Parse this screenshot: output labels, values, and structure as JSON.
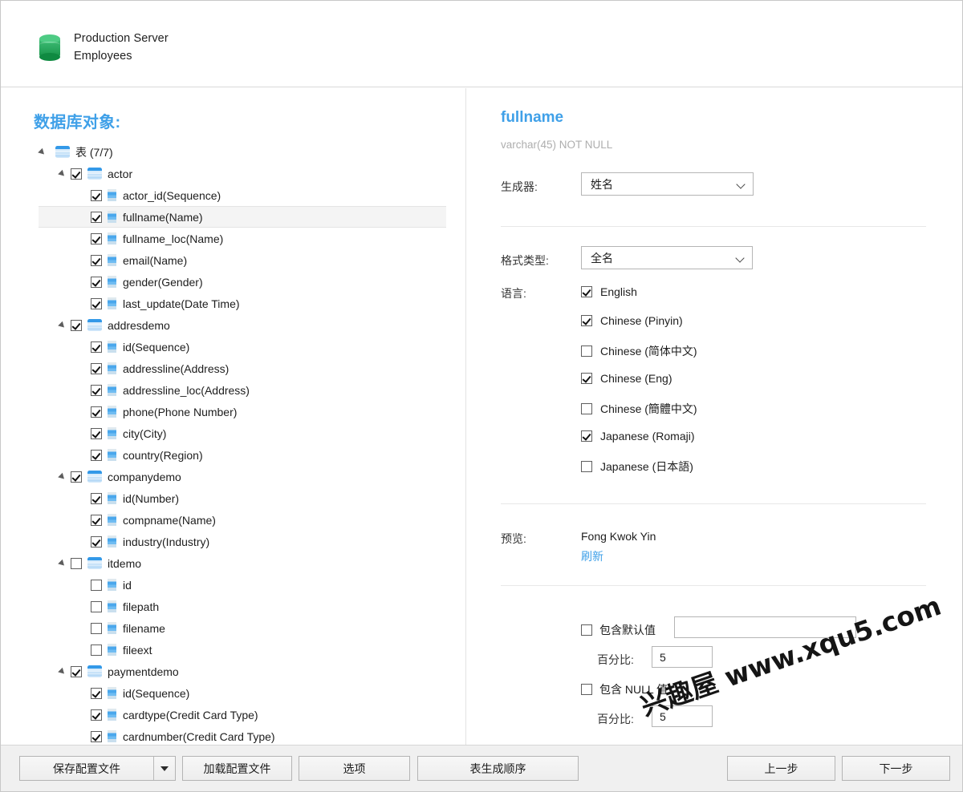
{
  "header": {
    "icon": "database-icon",
    "server": "Production Server",
    "database": "Employees"
  },
  "left_panel": {
    "title": "数据库对象:",
    "tree": [
      {
        "level": 0,
        "twisty": true,
        "checkbox": "none",
        "icon": "table-group-icon",
        "label": "表 (7/7)",
        "selected": false
      },
      {
        "level": 1,
        "twisty": true,
        "checkbox": "checked",
        "icon": "table-icon",
        "label": "actor",
        "selected": false
      },
      {
        "level": 2,
        "twisty": false,
        "checkbox": "checked",
        "icon": "column-icon",
        "label": "actor_id(Sequence)",
        "selected": false
      },
      {
        "level": 2,
        "twisty": false,
        "checkbox": "checked",
        "icon": "column-icon",
        "label": "fullname(Name)",
        "selected": true
      },
      {
        "level": 2,
        "twisty": false,
        "checkbox": "checked",
        "icon": "column-icon",
        "label": "fullname_loc(Name)",
        "selected": false
      },
      {
        "level": 2,
        "twisty": false,
        "checkbox": "checked",
        "icon": "column-icon",
        "label": "email(Name)",
        "selected": false
      },
      {
        "level": 2,
        "twisty": false,
        "checkbox": "checked",
        "icon": "column-icon",
        "label": "gender(Gender)",
        "selected": false
      },
      {
        "level": 2,
        "twisty": false,
        "checkbox": "checked",
        "icon": "column-icon",
        "label": "last_update(Date Time)",
        "selected": false
      },
      {
        "level": 1,
        "twisty": true,
        "checkbox": "checked",
        "icon": "table-icon",
        "label": "addresdemo",
        "selected": false
      },
      {
        "level": 2,
        "twisty": false,
        "checkbox": "checked",
        "icon": "column-icon",
        "label": "id(Sequence)",
        "selected": false
      },
      {
        "level": 2,
        "twisty": false,
        "checkbox": "checked",
        "icon": "column-icon",
        "label": "addressline(Address)",
        "selected": false
      },
      {
        "level": 2,
        "twisty": false,
        "checkbox": "checked",
        "icon": "column-icon",
        "label": "addressline_loc(Address)",
        "selected": false
      },
      {
        "level": 2,
        "twisty": false,
        "checkbox": "checked",
        "icon": "column-icon",
        "label": "phone(Phone Number)",
        "selected": false
      },
      {
        "level": 2,
        "twisty": false,
        "checkbox": "checked",
        "icon": "column-icon",
        "label": "city(City)",
        "selected": false
      },
      {
        "level": 2,
        "twisty": false,
        "checkbox": "checked",
        "icon": "column-icon",
        "label": "country(Region)",
        "selected": false
      },
      {
        "level": 1,
        "twisty": true,
        "checkbox": "checked",
        "icon": "table-icon",
        "label": "companydemo",
        "selected": false
      },
      {
        "level": 2,
        "twisty": false,
        "checkbox": "checked",
        "icon": "column-icon",
        "label": "id(Number)",
        "selected": false
      },
      {
        "level": 2,
        "twisty": false,
        "checkbox": "checked",
        "icon": "column-icon",
        "label": "compname(Name)",
        "selected": false
      },
      {
        "level": 2,
        "twisty": false,
        "checkbox": "checked",
        "icon": "column-icon",
        "label": "industry(Industry)",
        "selected": false
      },
      {
        "level": 1,
        "twisty": true,
        "checkbox": "unchecked",
        "icon": "table-icon",
        "label": "itdemo",
        "selected": false
      },
      {
        "level": 2,
        "twisty": false,
        "checkbox": "unchecked",
        "icon": "column-icon",
        "label": "id",
        "selected": false
      },
      {
        "level": 2,
        "twisty": false,
        "checkbox": "unchecked",
        "icon": "column-icon",
        "label": "filepath",
        "selected": false
      },
      {
        "level": 2,
        "twisty": false,
        "checkbox": "unchecked",
        "icon": "column-icon",
        "label": "filename",
        "selected": false
      },
      {
        "level": 2,
        "twisty": false,
        "checkbox": "unchecked",
        "icon": "column-icon",
        "label": "fileext",
        "selected": false
      },
      {
        "level": 1,
        "twisty": true,
        "checkbox": "checked",
        "icon": "table-icon",
        "label": "paymentdemo",
        "selected": false
      },
      {
        "level": 2,
        "twisty": false,
        "checkbox": "checked",
        "icon": "column-icon",
        "label": "id(Sequence)",
        "selected": false
      },
      {
        "level": 2,
        "twisty": false,
        "checkbox": "checked",
        "icon": "column-icon",
        "label": "cardtype(Credit Card Type)",
        "selected": false
      },
      {
        "level": 2,
        "twisty": false,
        "checkbox": "checked",
        "icon": "column-icon",
        "label": "cardnumber(Credit Card Type)",
        "selected": false
      }
    ]
  },
  "right_panel": {
    "field_name": "fullname",
    "field_type": "varchar(45) NOT NULL",
    "generator_label": "生成器:",
    "generator_value": "姓名",
    "format_label": "格式类型:",
    "format_value": "全名",
    "language_label": "语言:",
    "languages": [
      {
        "label": "English",
        "checked": true
      },
      {
        "label": "Chinese (Pinyin)",
        "checked": true
      },
      {
        "label": "Chinese (简体中文)",
        "checked": false
      },
      {
        "label": "Chinese (Eng)",
        "checked": true
      },
      {
        "label": "Chinese (簡體中文)",
        "checked": false
      },
      {
        "label": "Japanese (Romaji)",
        "checked": true
      },
      {
        "label": "Japanese (日本語)",
        "checked": false
      }
    ],
    "preview_label": "预览:",
    "preview_value": "Fong Kwok Yin",
    "refresh_label": "刷新",
    "include_default_label": "包含默认值",
    "include_default_checked": false,
    "include_default_value": "",
    "include_default_percent_label": "百分比:",
    "include_default_percent": "5",
    "include_null_label": "包含 NULL 值",
    "include_null_checked": false,
    "include_null_percent_label": "百分比:",
    "include_null_percent": "5"
  },
  "footer": {
    "save_config": "保存配置文件",
    "load_config": "加载配置文件",
    "options": "选项",
    "table_order": "表生成顺序",
    "back": "上一步",
    "next": "下一步"
  },
  "watermark": "兴趣屋 www.xqu5.com",
  "colors": {
    "accent": "#3fa0e8",
    "db_green": "#2eab63",
    "text": "#1d1d1d",
    "muted": "#aeaeae"
  }
}
